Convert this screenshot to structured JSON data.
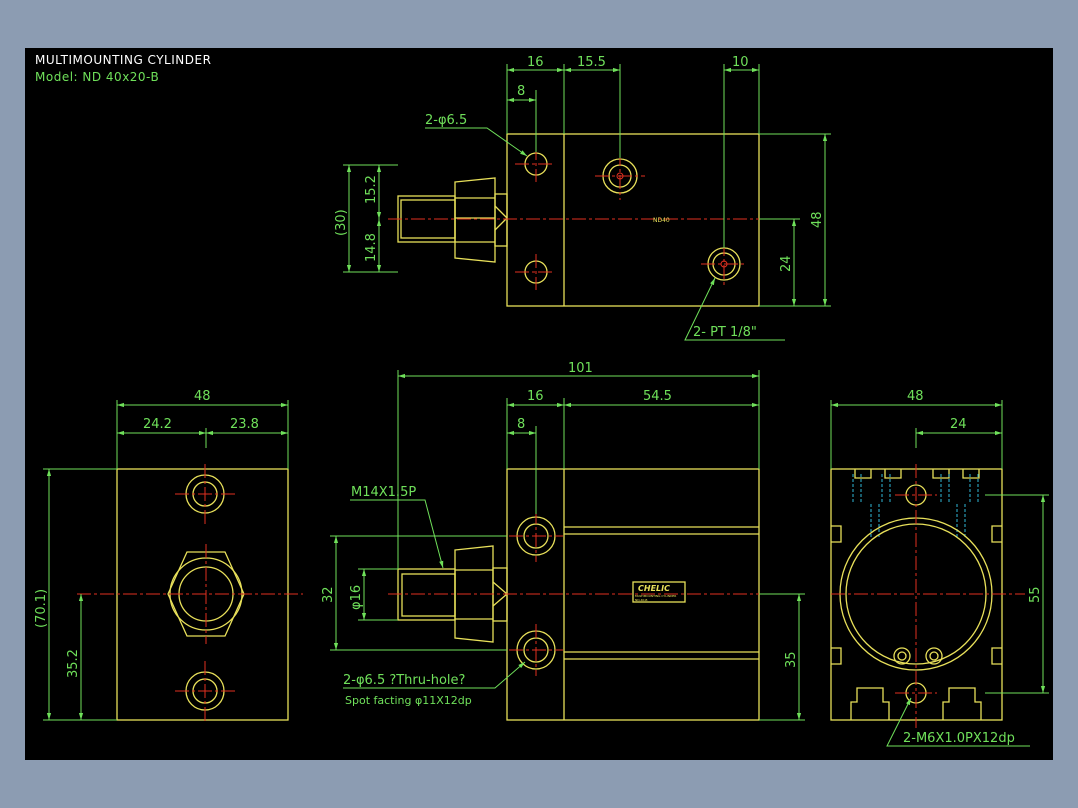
{
  "title_block": {
    "line1": "MULTIMOUNTING CYLINDER",
    "line2": "Model:  ND 40x20-B"
  },
  "colors": {
    "background": "#000000",
    "frame": "#8c9cb2",
    "dimension": "#6fe05a",
    "outline": "#e8e05a",
    "centerline": "#e03020",
    "hidden": "#30b8d8",
    "title": "#ffffff"
  },
  "top_view": {
    "dims": {
      "d16": "16",
      "d15_5": "15.5",
      "d10": "10",
      "d8": "8",
      "d15_2": "15.2",
      "d30": "(30)",
      "d14_8": "14.8",
      "d48": "48",
      "d24": "24",
      "center_mark": "ND40"
    },
    "callouts": {
      "holes": "2-φ6.5",
      "ports": "2- PT 1/8\""
    }
  },
  "left_view": {
    "dims": {
      "d48": "48",
      "d24_2": "24.2",
      "d23_8": "23.8",
      "d70_1": "(70.1)",
      "d35_2": "35.2"
    }
  },
  "front_view": {
    "dims": {
      "d101": "101",
      "d16": "16",
      "d54_5": "54.5",
      "d8": "8",
      "d32": "32",
      "d16dia": "φ16",
      "d35": "35"
    },
    "callouts": {
      "thread": "M14X1.5P",
      "holes_line1": "2-φ6.5 ?Thru-hole?",
      "holes_line2": "Spot facting  φ11X12dp"
    },
    "label_brand": "CHELIC",
    "label_sub": "MULTIMOUNTING CYLINDER",
    "label_model": "ND-40-B"
  },
  "right_view": {
    "dims": {
      "d48": "48",
      "d24": "24",
      "d55": "55"
    },
    "callouts": {
      "taps": "2-M6X1.0PX12dp"
    }
  }
}
